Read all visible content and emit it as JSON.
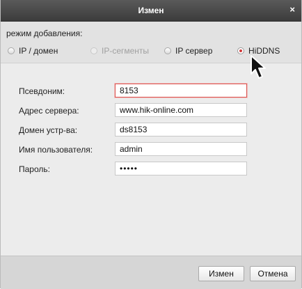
{
  "window": {
    "title": "Измен",
    "close_glyph": "×"
  },
  "mode": {
    "label": "режим добавления:",
    "options": [
      {
        "label": "IP / домен",
        "checked": false,
        "disabled": false
      },
      {
        "label": "IP-сегменты",
        "checked": false,
        "disabled": true
      },
      {
        "label": "IP сервер",
        "checked": false,
        "disabled": false
      },
      {
        "label": "HiDDNS",
        "checked": true,
        "disabled": false
      }
    ]
  },
  "form": {
    "alias": {
      "label": "Псевдоним:",
      "value": "8153"
    },
    "server_address": {
      "label": "Адрес сервера:",
      "value": "www.hik-online.com"
    },
    "device_domain": {
      "label": "Домен устр-ва:",
      "value": "ds8153"
    },
    "username": {
      "label": "Имя пользователя:",
      "value": "admin"
    },
    "password": {
      "label": "Пароль:",
      "value": "•••••"
    }
  },
  "buttons": {
    "ok": "Измен",
    "cancel": "Отмена"
  },
  "colors": {
    "accent": "#d23a3a",
    "titlebar": "#4a4a4a"
  },
  "icons": {
    "pointer": "mouse-pointer-icon"
  }
}
